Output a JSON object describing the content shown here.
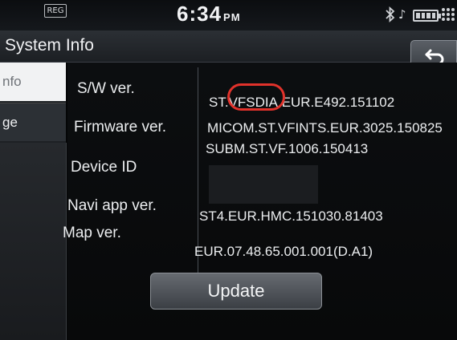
{
  "status_bar": {
    "reg_badge": "REG",
    "time": "6:34",
    "ampm": "PM",
    "icons": [
      "bluetooth-icon",
      "music-note-icon",
      "battery-icon",
      "signal-dots-icon"
    ]
  },
  "title_bar": {
    "title": "System Info",
    "back_icon": "return-arrow-icon"
  },
  "sidebar": {
    "items": [
      {
        "label": "nfo",
        "active": true
      },
      {
        "label": "ge",
        "active": false
      }
    ]
  },
  "info": {
    "sw_label": "S/W ver.",
    "sw_prefix": "ST.",
    "sw_highlight": "VFSDIA.",
    "sw_suffix": "EUR.E492.151102",
    "firmware_label": "Firmware ver.",
    "firmware_value_1": "MICOM.ST.VFINTS.EUR.3025.150825",
    "firmware_value_2": "SUBM.ST.VF.1006.150413",
    "device_label": "Device ID",
    "navi_label": "Navi app ver.",
    "navi_value": "ST4.EUR.HMC.151030.81403",
    "map_label": "Map ver.",
    "map_value": "EUR.07.48.65.001.001(D.A1)"
  },
  "update_button": "Update",
  "colors": {
    "highlight_ring": "#e1322b",
    "background": "#050607"
  }
}
